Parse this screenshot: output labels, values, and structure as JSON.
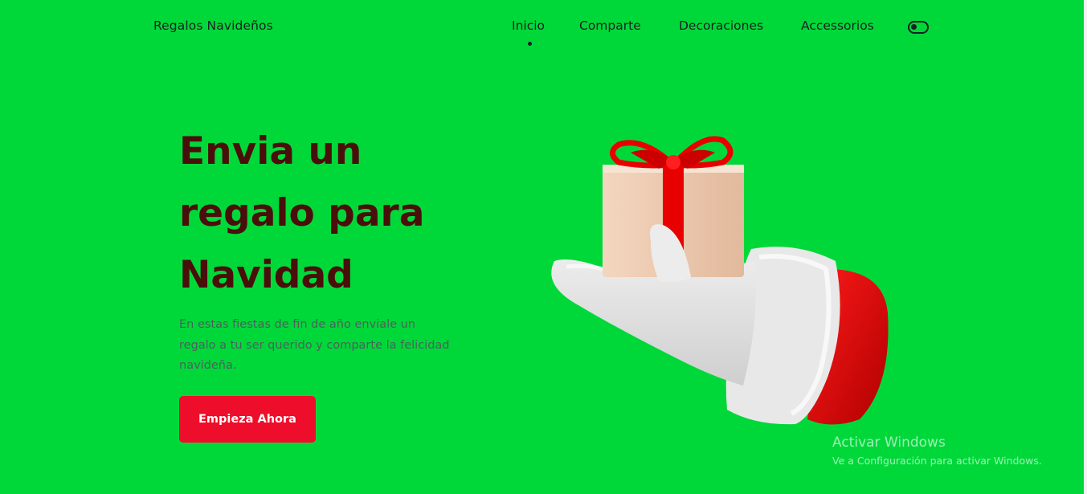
{
  "header": {
    "logo": "Regalos Navideños",
    "nav": [
      {
        "label": "Inicio",
        "active": true
      },
      {
        "label": "Comparte",
        "active": false
      },
      {
        "label": "Decoraciones",
        "active": false
      },
      {
        "label": "Accessorios",
        "active": false
      }
    ],
    "theme_toggle_icon": "toggle-icon"
  },
  "hero": {
    "title_line1": "Envia un",
    "title_line2": "regalo para",
    "title_line3": "Navidad",
    "description": "En estas fiestas de fin de año enviale un regalo a tu ser querido y comparte la felicidad navideña.",
    "button_label": "Empieza Ahora",
    "image_icon": "santa-hand-gift-icon"
  },
  "watermark": {
    "title": "Activar Windows",
    "subtitle": "Ve a Configuración para activar Windows."
  },
  "colors": {
    "background": "#00d83a",
    "title": "#4a0f0a",
    "button": "#ee0d2a",
    "text_dark": "#1c1f22"
  }
}
